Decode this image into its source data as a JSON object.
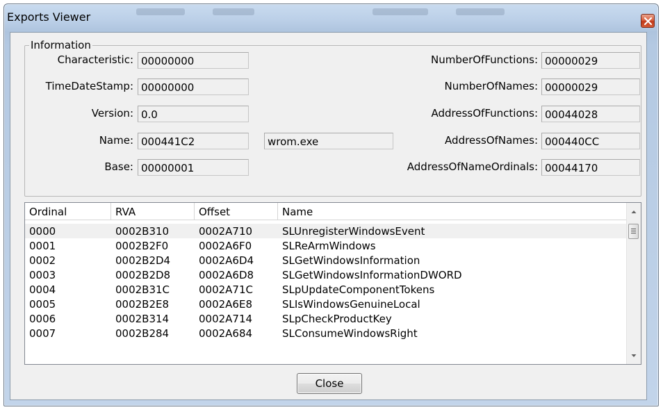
{
  "window": {
    "title": "Exports Viewer"
  },
  "info": {
    "legend": "Information",
    "characteristic": {
      "label": "Characteristic:",
      "value": "00000000"
    },
    "timedatestamp": {
      "label": "TimeDateStamp:",
      "value": "00000000"
    },
    "version": {
      "label": "Version:",
      "value": "0.0"
    },
    "name": {
      "label": "Name:",
      "value": "000441C2",
      "string": "wrom.exe"
    },
    "base": {
      "label": "Base:",
      "value": "00000001"
    },
    "number_of_functions": {
      "label": "NumberOfFunctions:",
      "value": "00000029"
    },
    "number_of_names": {
      "label": "NumberOfNames:",
      "value": "00000029"
    },
    "address_of_functions": {
      "label": "AddressOfFunctions:",
      "value": "00044028"
    },
    "address_of_names": {
      "label": "AddressOfNames:",
      "value": "000440CC"
    },
    "address_of_name_ordinals": {
      "label": "AddressOfNameOrdinals:",
      "value": "00044170"
    }
  },
  "exports": {
    "columns": [
      "Ordinal",
      "RVA",
      "Offset",
      "Name"
    ],
    "rows": [
      [
        "0000",
        "0002B310",
        "0002A710",
        "SLUnregisterWindowsEvent"
      ],
      [
        "0001",
        "0002B2F0",
        "0002A6F0",
        "SLReArmWindows"
      ],
      [
        "0002",
        "0002B2D4",
        "0002A6D4",
        "SLGetWindowsInformation"
      ],
      [
        "0003",
        "0002B2D8",
        "0002A6D8",
        "SLGetWindowsInformationDWORD"
      ],
      [
        "0004",
        "0002B31C",
        "0002A71C",
        "SLpUpdateComponentTokens"
      ],
      [
        "0005",
        "0002B2E8",
        "0002A6E8",
        "SLIsWindowsGenuineLocal"
      ],
      [
        "0006",
        "0002B314",
        "0002A714",
        "SLpCheckProductKey"
      ],
      [
        "0007",
        "0002B284",
        "0002A684",
        "SLConsumeWindowsRight"
      ]
    ],
    "highlighted_row": 0
  },
  "buttons": {
    "close": "Close"
  },
  "icons": {
    "close": "close-icon",
    "scroll_up": "chevron-up-icon",
    "scroll_down": "chevron-down-icon"
  }
}
